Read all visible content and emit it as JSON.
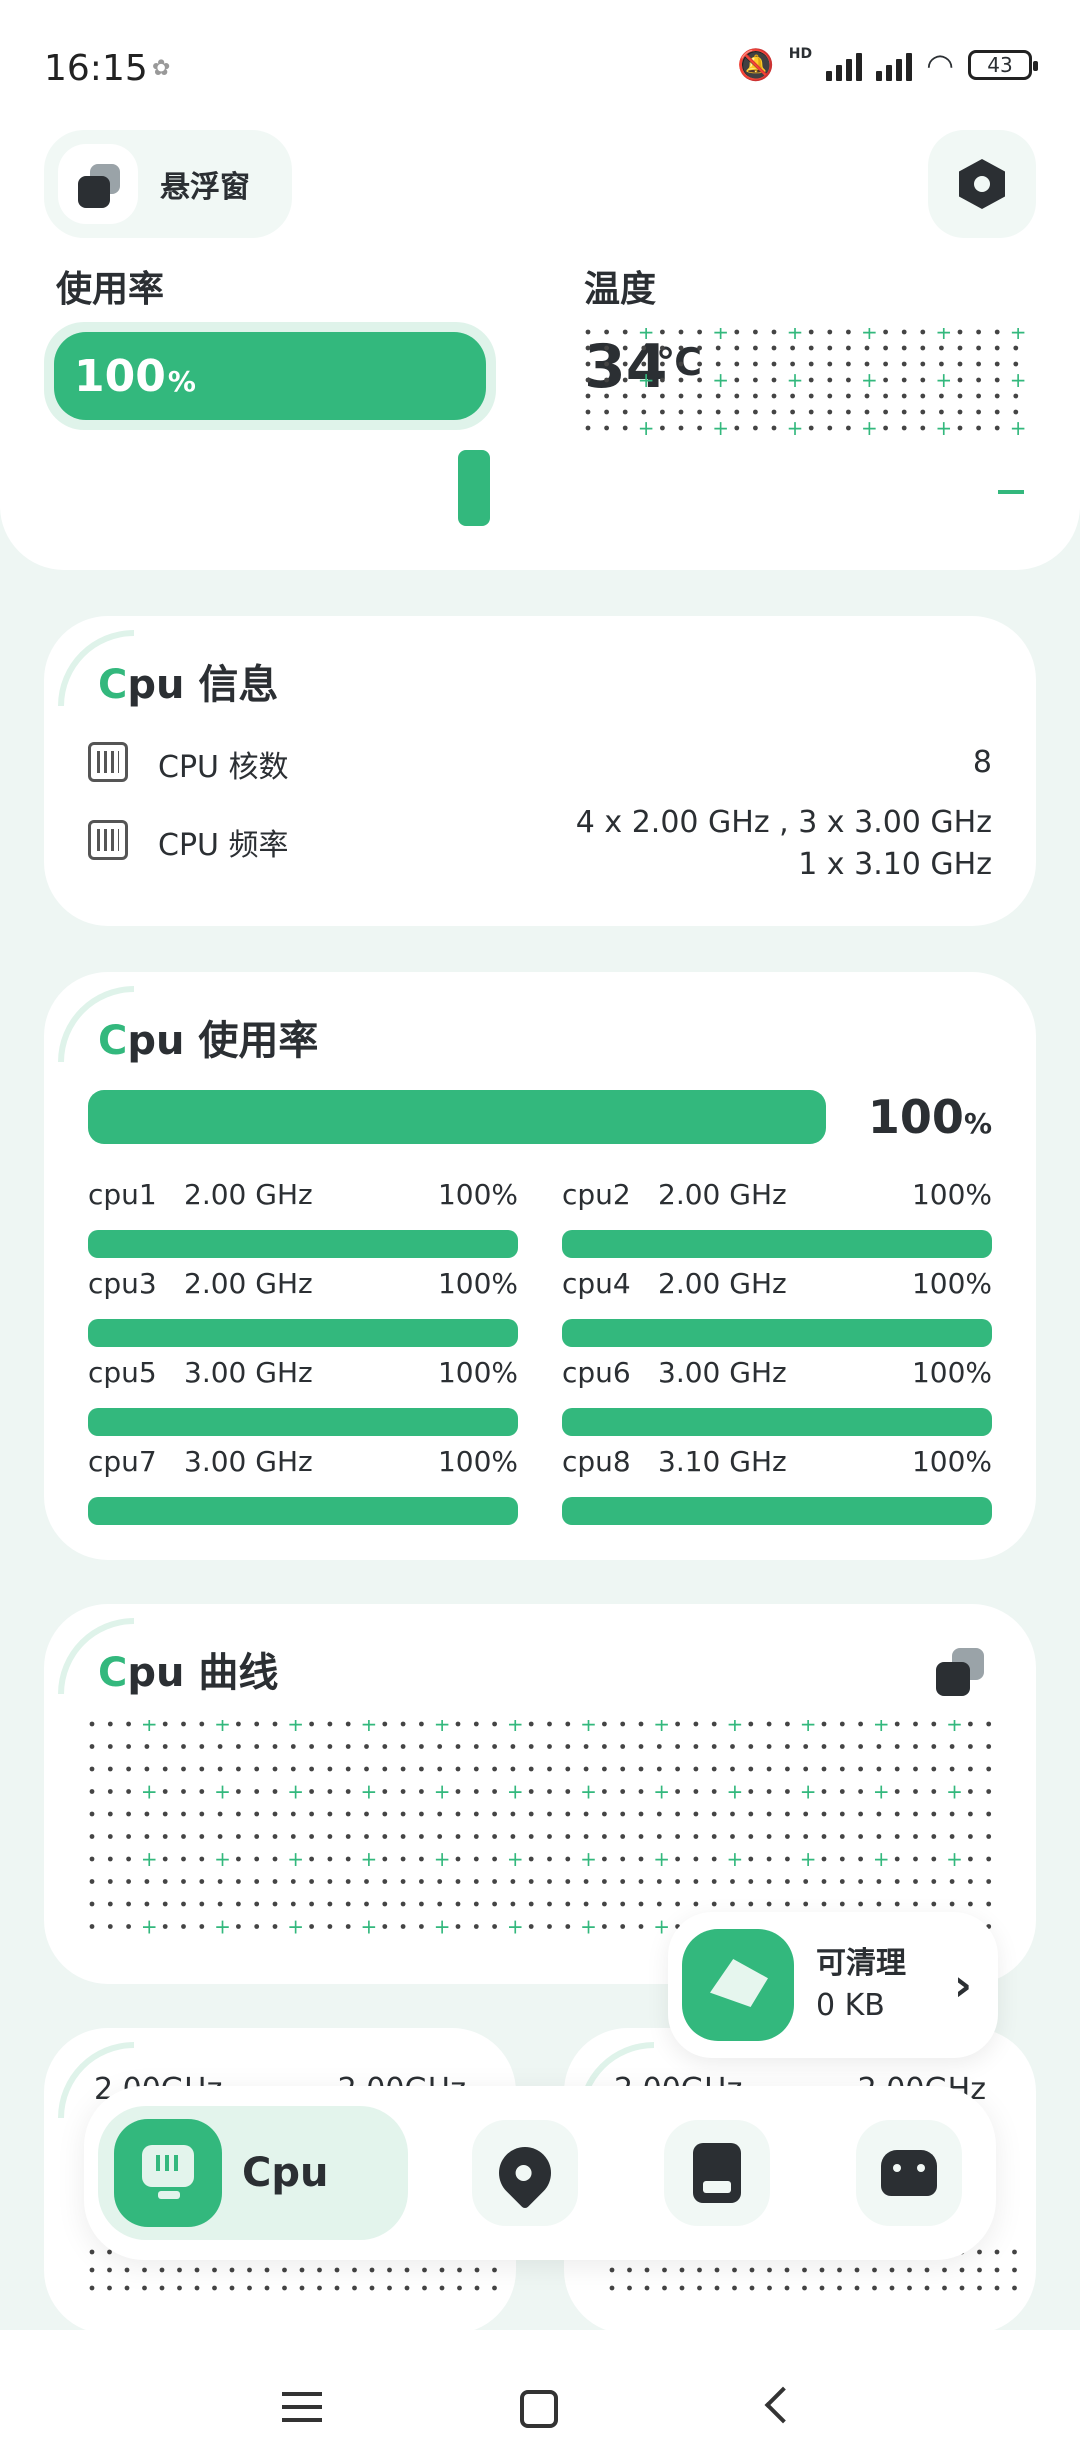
{
  "status_bar": {
    "time": "16:15",
    "network_label": "HD",
    "battery": "43"
  },
  "header": {
    "float_window_label": "悬浮窗",
    "usage_title": "使用率",
    "usage_value": "100",
    "usage_unit": "%",
    "temp_title": "温度",
    "temp_value": "34",
    "temp_unit": "℃"
  },
  "cpu_info": {
    "title_accent": "C",
    "title_rest": "pu 信息",
    "rows": [
      {
        "label": "CPU 核数",
        "value": "8",
        "icon": "chip-icon"
      },
      {
        "label": "CPU 频率",
        "value_line1": "4 x 2.00 GHz , 3 x 3.00 GHz",
        "value_line2": "1 x 3.10 GHz",
        "icon": "frequency-chip-icon"
      }
    ]
  },
  "cpu_usage": {
    "title_accent": "C",
    "title_rest": "pu 使用率",
    "total_value": "100",
    "total_unit": "%",
    "cores": [
      {
        "name": "cpu1",
        "freq": "2.00 GHz",
        "pct": "100%"
      },
      {
        "name": "cpu2",
        "freq": "2.00 GHz",
        "pct": "100%"
      },
      {
        "name": "cpu3",
        "freq": "2.00 GHz",
        "pct": "100%"
      },
      {
        "name": "cpu4",
        "freq": "2.00 GHz",
        "pct": "100%"
      },
      {
        "name": "cpu5",
        "freq": "3.00 GHz",
        "pct": "100%"
      },
      {
        "name": "cpu6",
        "freq": "3.00 GHz",
        "pct": "100%"
      },
      {
        "name": "cpu7",
        "freq": "3.00 GHz",
        "pct": "100%"
      },
      {
        "name": "cpu8",
        "freq": "3.10 GHz",
        "pct": "100%"
      }
    ]
  },
  "cpu_curve": {
    "title_accent": "C",
    "title_rest": "pu 曲线"
  },
  "clean": {
    "label": "可清理",
    "value": "0 KB"
  },
  "small_cards": [
    {
      "left": "2.00GHz",
      "right": "2.00GHz"
    },
    {
      "left": "2.00GHz",
      "right": "2.00GHz"
    }
  ],
  "bottom_nav": {
    "active_label": "Cpu",
    "items": [
      "cpu-monitor-icon",
      "rocket-icon",
      "memory-icon",
      "android-icon"
    ]
  },
  "colors": {
    "accent": "#33b87d",
    "background": "#eef6f3",
    "card": "#ffffff",
    "text": "#2b2f33"
  }
}
